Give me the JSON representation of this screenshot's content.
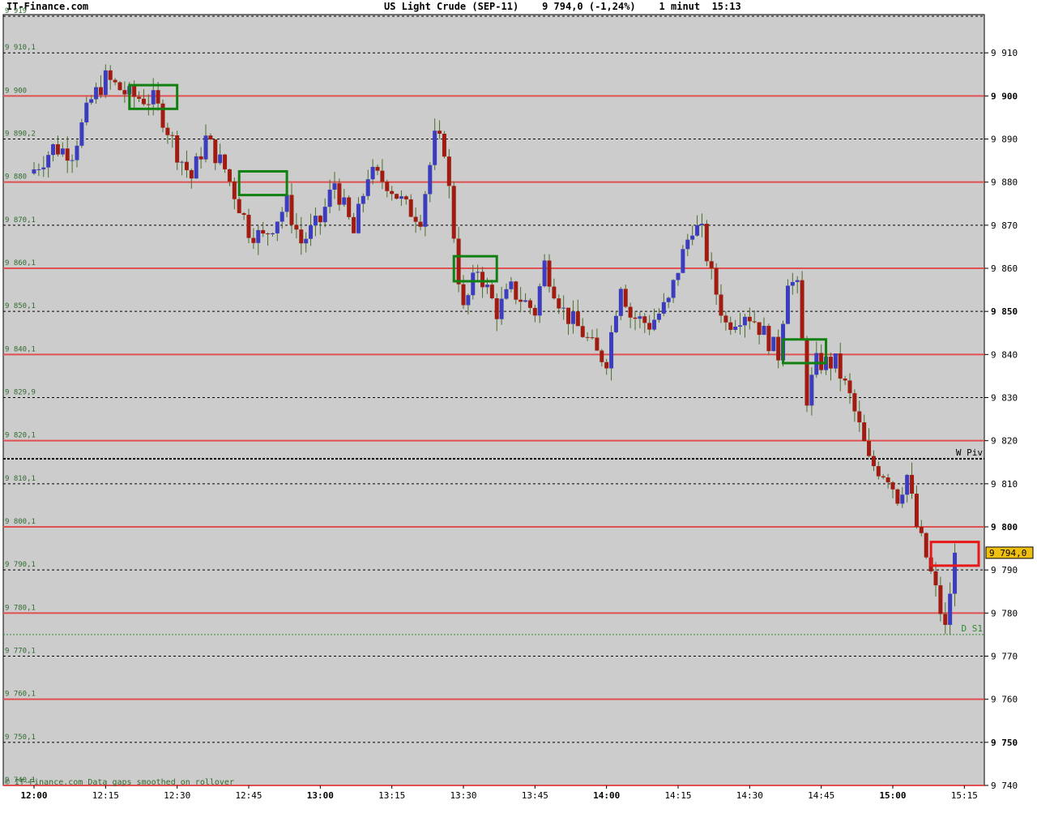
{
  "header": {
    "site": "IT-Finance.com",
    "title_line": "US Light Crude (SEP-11)    9 794,0 (-1,24%)    1 minut  15:13"
  },
  "footer_note": "© IT-Finance.com Data gaps smoothed on rollover",
  "colors": {
    "background": "#cccccc",
    "bull": "#3c3cbe",
    "bear": "#a01c10",
    "wick": "#4c6e2c",
    "level_line": "#e05050",
    "marker_green": "#108010",
    "marker_red": "#e81818",
    "price_tag": "#f0c010"
  },
  "chart_data": {
    "type": "candlestick",
    "title": "US Light Crude (SEP-11)",
    "timeframe": "1 minut",
    "last_price_label": "9 794,0",
    "ylim": [
      9738.5,
      9919
    ],
    "xlim": [
      "11:55",
      "15:23"
    ],
    "x_ticks": [
      {
        "time": "12:00",
        "label": "12:00",
        "bold": true
      },
      {
        "time": "12:15",
        "label": "12:15",
        "bold": false
      },
      {
        "time": "12:30",
        "label": "12:30",
        "bold": false
      },
      {
        "time": "12:45",
        "label": "12:45",
        "bold": false
      },
      {
        "time": "13:00",
        "label": "13:00",
        "bold": true
      },
      {
        "time": "13:15",
        "label": "13:15",
        "bold": false
      },
      {
        "time": "13:30",
        "label": "13:30",
        "bold": false
      },
      {
        "time": "13:45",
        "label": "13:45",
        "bold": false
      },
      {
        "time": "14:00",
        "label": "14:00",
        "bold": true
      },
      {
        "time": "14:15",
        "label": "14:15",
        "bold": false
      },
      {
        "time": "14:30",
        "label": "14:30",
        "bold": false
      },
      {
        "time": "14:45",
        "label": "14:45",
        "bold": false
      },
      {
        "time": "15:00",
        "label": "15:00",
        "bold": true
      },
      {
        "time": "15:15",
        "label": "15:15",
        "bold": false
      }
    ],
    "y_ticks": [
      {
        "value": 9910,
        "label": "9 910",
        "bold": false
      },
      {
        "value": 9900,
        "label": "9 900",
        "bold": true
      },
      {
        "value": 9890,
        "label": "9 890",
        "bold": false
      },
      {
        "value": 9880,
        "label": "9 880",
        "bold": false
      },
      {
        "value": 9870,
        "label": "9 870",
        "bold": false
      },
      {
        "value": 9860,
        "label": "9 860",
        "bold": false
      },
      {
        "value": 9850,
        "label": "9 850",
        "bold": true
      },
      {
        "value": 9840,
        "label": "9 840",
        "bold": false
      },
      {
        "value": 9830,
        "label": "9 830",
        "bold": false
      },
      {
        "value": 9820,
        "label": "9 820",
        "bold": false
      },
      {
        "value": 9810,
        "label": "9 810",
        "bold": false
      },
      {
        "value": 9800,
        "label": "9 800",
        "bold": true
      },
      {
        "value": 9790,
        "label": "9 790",
        "bold": false
      },
      {
        "value": 9780,
        "label": "9 780",
        "bold": false
      },
      {
        "value": 9770,
        "label": "9 770",
        "bold": false
      },
      {
        "value": 9760,
        "label": "9 760",
        "bold": false
      },
      {
        "value": 9750,
        "label": "9 750",
        "bold": true
      },
      {
        "value": 9740,
        "label": "9 740",
        "bold": false
      }
    ],
    "red_levels": [
      9900,
      9880,
      9860,
      9840,
      9820,
      9800,
      9780,
      9760,
      9740
    ],
    "dotted_levels": [
      9910,
      9890,
      9870,
      9850,
      9830,
      9810,
      9790,
      9770,
      9750
    ],
    "left_labels": [
      {
        "value": 9918.5,
        "label": "9 919"
      },
      {
        "value": 9910,
        "label": "9 910,1"
      },
      {
        "value": 9900,
        "label": "9 900"
      },
      {
        "value": 9890,
        "label": "9 890,2"
      },
      {
        "value": 9880,
        "label": "9 880"
      },
      {
        "value": 9870,
        "label": "9 870,1"
      },
      {
        "value": 9860,
        "label": "9 860,1"
      },
      {
        "value": 9850,
        "label": "9 850,1"
      },
      {
        "value": 9840,
        "label": "9 840,1"
      },
      {
        "value": 9830,
        "label": "9 829,9"
      },
      {
        "value": 9820,
        "label": "9 820,1"
      },
      {
        "value": 9810,
        "label": "9 810,1"
      },
      {
        "value": 9800,
        "label": "9 800,1"
      },
      {
        "value": 9790,
        "label": "9 790,1"
      },
      {
        "value": 9780,
        "label": "9 780,1"
      },
      {
        "value": 9770,
        "label": "9 770,1"
      },
      {
        "value": 9760,
        "label": "9 760,1"
      },
      {
        "value": 9750,
        "label": "9 750,1"
      },
      {
        "value": 9740,
        "label": "9 740,1"
      }
    ],
    "pivots": [
      {
        "name": "W Piv",
        "value": 9815.8,
        "style": "thick-dotted",
        "color": "#000000"
      },
      {
        "name": "D S1",
        "value": 9775,
        "style": "dashed",
        "color": "#2c8a2c"
      }
    ],
    "last_price": 9794.0,
    "markers": [
      {
        "t1": "12:20",
        "t2": "12:30",
        "low": 9897,
        "high": 9902.5,
        "color": "green"
      },
      {
        "t1": "12:43",
        "t2": "12:53",
        "low": 9877,
        "high": 9882.5,
        "color": "green"
      },
      {
        "t1": "13:28",
        "t2": "13:37",
        "low": 9857,
        "high": 9862.8,
        "color": "green"
      },
      {
        "t1": "14:37",
        "t2": "14:46",
        "low": 9838,
        "high": 9843.5,
        "color": "green"
      },
      {
        "t1": "15:08",
        "t2": "15:18",
        "low": 9791,
        "high": 9796.5,
        "color": "red"
      }
    ],
    "candle_anchors": [
      [
        "12:00",
        9883
      ],
      [
        "12:04",
        9888
      ],
      [
        "12:08",
        9887
      ],
      [
        "12:12",
        9899
      ],
      [
        "12:15",
        9904
      ],
      [
        "12:20",
        9900
      ],
      [
        "12:25",
        9899
      ],
      [
        "12:27",
        9895
      ],
      [
        "12:30",
        9887
      ],
      [
        "12:33",
        9881
      ],
      [
        "12:36",
        9890
      ],
      [
        "12:40",
        9883
      ],
      [
        "12:45",
        9869
      ],
      [
        "12:48",
        9867
      ],
      [
        "12:53",
        9875
      ],
      [
        "12:56",
        9866
      ],
      [
        "13:00",
        9871
      ],
      [
        "13:03",
        9880
      ],
      [
        "13:07",
        9868
      ],
      [
        "13:10",
        9882
      ],
      [
        "13:14",
        9880
      ],
      [
        "13:18",
        9874
      ],
      [
        "13:21",
        9872
      ],
      [
        "13:24",
        9890
      ],
      [
        "13:26",
        9888
      ],
      [
        "13:29",
        9858
      ],
      [
        "13:30",
        9850
      ],
      [
        "13:33",
        9860
      ],
      [
        "13:37",
        9850
      ],
      [
        "13:40",
        9855
      ],
      [
        "13:45",
        9850
      ],
      [
        "13:47",
        9861
      ],
      [
        "13:51",
        9850
      ],
      [
        "13:55",
        9845
      ],
      [
        "13:58",
        9840
      ],
      [
        "14:00",
        9839
      ],
      [
        "14:03",
        9857
      ],
      [
        "14:05",
        9849
      ],
      [
        "14:09",
        9847
      ],
      [
        "14:13",
        9852
      ],
      [
        "14:15",
        9860
      ],
      [
        "14:18",
        9870
      ],
      [
        "14:20",
        9868
      ],
      [
        "14:22",
        9858
      ],
      [
        "14:25",
        9847
      ],
      [
        "14:29",
        9850
      ],
      [
        "14:31",
        9848
      ],
      [
        "14:36",
        9840
      ],
      [
        "14:38",
        9858
      ],
      [
        "14:40",
        9855
      ],
      [
        "14:42",
        9830
      ],
      [
        "14:44",
        9838
      ],
      [
        "14:46",
        9838
      ],
      [
        "14:48",
        9838
      ],
      [
        "14:51",
        9830
      ],
      [
        "14:53",
        9823
      ],
      [
        "14:55",
        9815
      ],
      [
        "14:59",
        9812
      ],
      [
        "15:01",
        9807
      ],
      [
        "15:03",
        9812
      ],
      [
        "15:05",
        9800
      ],
      [
        "15:07",
        9793
      ],
      [
        "15:09",
        9785
      ],
      [
        "15:11",
        9776
      ],
      [
        "15:13",
        9794
      ]
    ]
  }
}
